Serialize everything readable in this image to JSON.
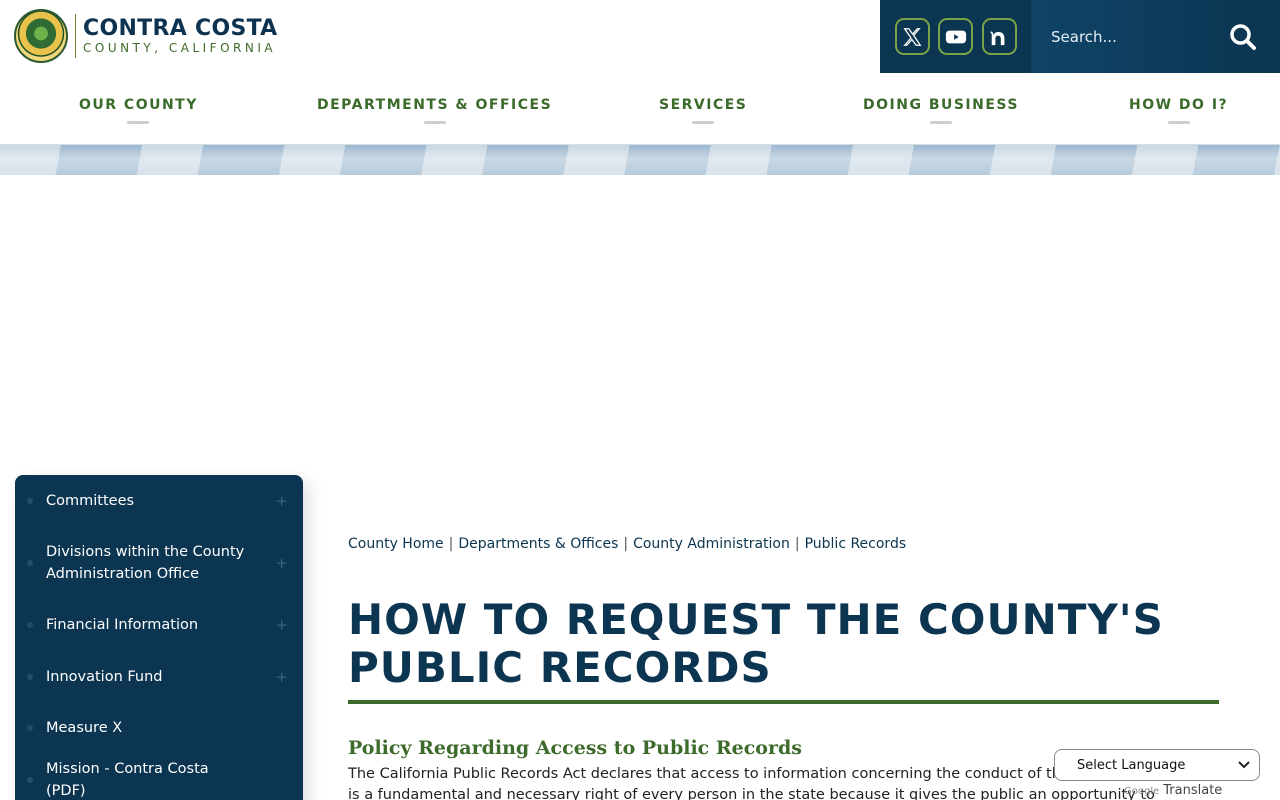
{
  "header": {
    "logo_title": "CONTRA COSTA",
    "logo_subtitle": "COUNTY, CALIFORNIA",
    "social": [
      {
        "icon": "x-twitter-icon",
        "glyph": "𝕏"
      },
      {
        "icon": "youtube-icon",
        "glyph": "▶"
      },
      {
        "icon": "nextdoor-icon",
        "glyph": "n"
      }
    ],
    "search_placeholder": "Search..."
  },
  "nav": {
    "items": [
      {
        "label": "OUR COUNTY"
      },
      {
        "label": "DEPARTMENTS & OFFICES"
      },
      {
        "label": "SERVICES"
      },
      {
        "label": "DOING BUSINESS"
      },
      {
        "label": "HOW DO I?"
      }
    ]
  },
  "sidebar": {
    "items": [
      {
        "label": "Committees",
        "expandable": true
      },
      {
        "label": "Divisions within the County Administration Office",
        "expandable": true
      },
      {
        "label": "Financial Information",
        "expandable": true
      },
      {
        "label": "Innovation Fund",
        "expandable": true
      },
      {
        "label": "Measure X",
        "expandable": false
      },
      {
        "label": "Mission - Contra Costa (PDF)",
        "expandable": false
      }
    ]
  },
  "breadcrumb": {
    "items": [
      "County Home",
      "Departments & Offices",
      "County Administration",
      "Public Records"
    ],
    "separator": "|"
  },
  "main": {
    "title": "HOW TO REQUEST THE COUNTY'S PUBLIC RECORDS",
    "section_heading": "Policy Regarding Access to Public Records",
    "body": "The California Public Records Act declares that access to information concerning the conduct of the people's business is a fundamental and necessary right of every person in the state because it gives the public an opportunity to monitor the"
  },
  "translate": {
    "select_label": "Select Language",
    "powered_google": "Google",
    "powered_label": "Translate"
  },
  "colors": {
    "navy": "#0b3550",
    "green": "#3d6b2b",
    "accent_border": "#7aa347"
  }
}
